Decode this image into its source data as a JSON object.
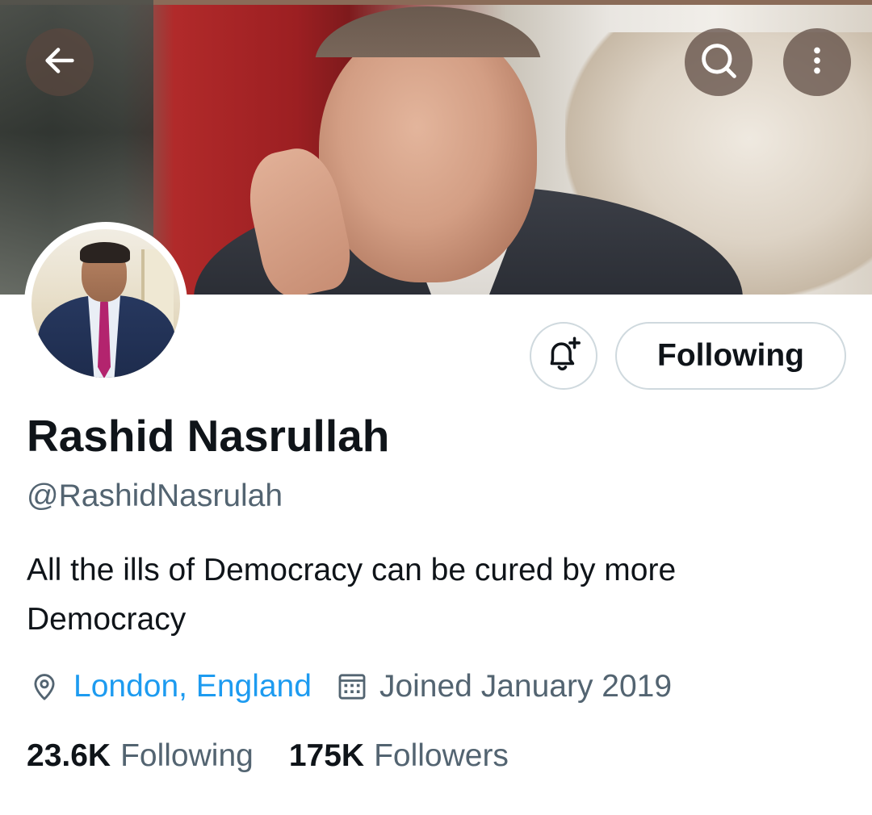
{
  "banner": {
    "back_icon": "arrow-left-icon",
    "search_icon": "search-icon",
    "more_icon": "more-vertical-icon"
  },
  "profile": {
    "display_name": "Rashid Nasrullah",
    "handle": "@RashidNasrulah",
    "bio": "All the ills of Democracy can be cured by more Democracy",
    "location": "London, England",
    "joined": "Joined January 2019",
    "location_icon": "location-pin-icon",
    "calendar_icon": "calendar-icon"
  },
  "actions": {
    "notify_icon": "bell-plus-icon",
    "following_label": "Following"
  },
  "stats": {
    "following_count": "23.6K",
    "following_label": "Following",
    "followers_count": "175K",
    "followers_label": "Followers"
  },
  "colors": {
    "link": "#1d9bf0",
    "secondary_text": "#536471",
    "primary_text": "#0f1419",
    "button_border": "#cfd9de"
  }
}
